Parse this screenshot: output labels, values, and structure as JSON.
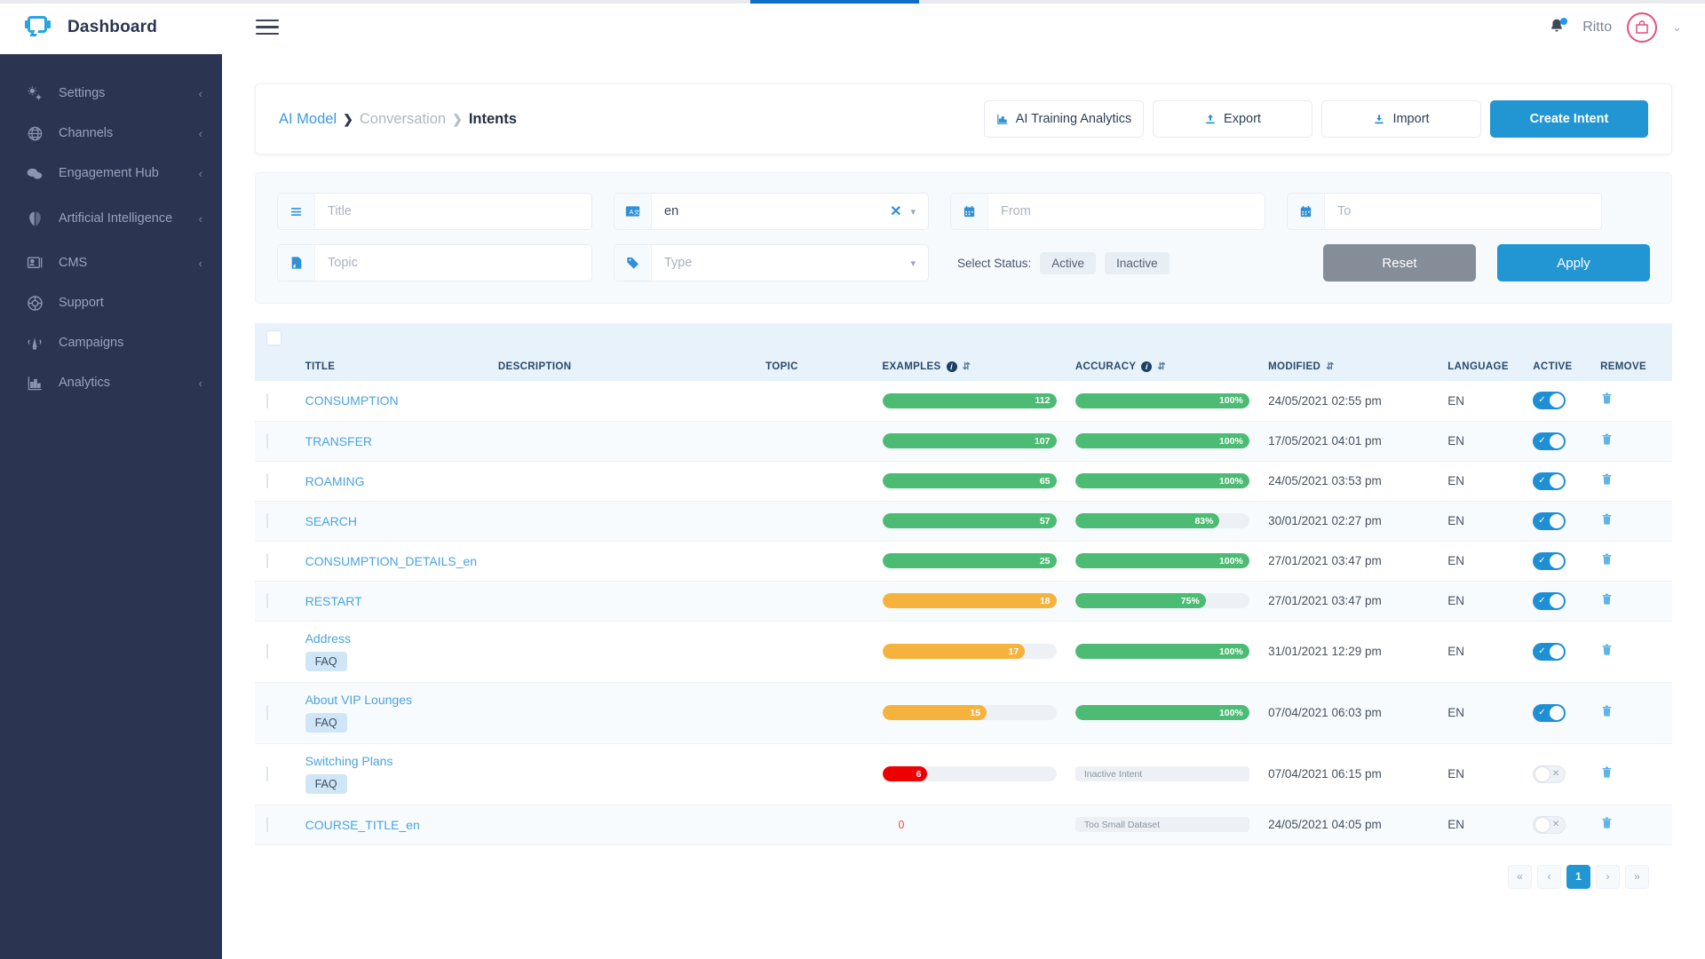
{
  "brand": {
    "title": "Dashboard",
    "logo_icon": "chat-bubble-logo"
  },
  "sidebar": {
    "items": [
      {
        "label": "Settings",
        "icon": "gears-icon",
        "chevron": "‹"
      },
      {
        "label": "Channels",
        "icon": "network-icon",
        "chevron": "‹"
      },
      {
        "label": "Engagement Hub",
        "icon": "chat-icon",
        "chevron": "‹"
      },
      {
        "label": "Artificial Intelligence",
        "icon": "brain-icon",
        "chevron": "‹"
      },
      {
        "label": "CMS",
        "icon": "content-icon",
        "chevron": "‹"
      },
      {
        "label": "Support",
        "icon": "lifebuoy-icon",
        "chevron": ""
      },
      {
        "label": "Campaigns",
        "icon": "megaphone-icon",
        "chevron": ""
      },
      {
        "label": "Analytics",
        "icon": "bar-chart-icon",
        "chevron": "‹"
      }
    ]
  },
  "topbar": {
    "menu_icon": "hamburger-icon",
    "bell_icon": "bell-icon",
    "username": "Ritto",
    "avatar_icon": "shopping-bag-avatar",
    "caret": "⌄"
  },
  "breadcrumb": {
    "level1": "AI Model",
    "sep1": "❯",
    "level2": "Conversation",
    "sep2": "❯",
    "level3": "Intents"
  },
  "actions": {
    "analytics": "AI Training Analytics",
    "export": "Export",
    "import": "Import",
    "create": "Create Intent"
  },
  "filters": {
    "title_placeholder": "Title",
    "language_value": "en",
    "from_placeholder": "From",
    "to_placeholder": "To",
    "topic_placeholder": "Topic",
    "type_placeholder": "Type",
    "status_label": "Select Status:",
    "status_active": "Active",
    "status_inactive": "Inactive",
    "reset": "Reset",
    "apply": "Apply"
  },
  "table": {
    "headers": {
      "title": "TITLE",
      "description": "DESCRIPTION",
      "topic": "TOPIC",
      "examples": "EXAMPLES",
      "accuracy": "ACCURACY",
      "modified": "MODIFIED",
      "language": "LANGUAGE",
      "active": "ACTIVE",
      "remove": "REMOVE"
    },
    "rows": [
      {
        "title": "CONSUMPTION",
        "badge": "",
        "description": "",
        "topic": "",
        "examples": "112",
        "examples_pct": 100,
        "examples_color": "green",
        "accuracy": "100%",
        "accuracy_pct": 100,
        "accuracy_color": "green",
        "accuracy_flat": "",
        "modified": "24/05/2021 02:55 pm",
        "language": "EN",
        "active": true
      },
      {
        "title": "TRANSFER",
        "badge": "",
        "description": "",
        "topic": "",
        "examples": "107",
        "examples_pct": 100,
        "examples_color": "green",
        "accuracy": "100%",
        "accuracy_pct": 100,
        "accuracy_color": "green",
        "accuracy_flat": "",
        "modified": "17/05/2021 04:01 pm",
        "language": "EN",
        "active": true
      },
      {
        "title": "ROAMING",
        "badge": "",
        "description": "",
        "topic": "",
        "examples": "65",
        "examples_pct": 100,
        "examples_color": "green",
        "accuracy": "100%",
        "accuracy_pct": 100,
        "accuracy_color": "green",
        "accuracy_flat": "",
        "modified": "24/05/2021 03:53 pm",
        "language": "EN",
        "active": true
      },
      {
        "title": "SEARCH",
        "badge": "",
        "description": "",
        "topic": "",
        "examples": "57",
        "examples_pct": 100,
        "examples_color": "green",
        "accuracy": "83%",
        "accuracy_pct": 83,
        "accuracy_color": "green",
        "accuracy_flat": "",
        "modified": "30/01/2021 02:27 pm",
        "language": "EN",
        "active": true
      },
      {
        "title": "CONSUMPTION_DETAILS_en",
        "badge": "",
        "description": "",
        "topic": "",
        "examples": "25",
        "examples_pct": 100,
        "examples_color": "green",
        "accuracy": "100%",
        "accuracy_pct": 100,
        "accuracy_color": "green",
        "accuracy_flat": "",
        "modified": "27/01/2021 03:47 pm",
        "language": "EN",
        "active": true
      },
      {
        "title": "RESTART",
        "badge": "",
        "description": "",
        "topic": "",
        "examples": "18",
        "examples_pct": 100,
        "examples_color": "orange",
        "accuracy": "75%",
        "accuracy_pct": 75,
        "accuracy_color": "green",
        "accuracy_flat": "",
        "modified": "27/01/2021 03:47 pm",
        "language": "EN",
        "active": true
      },
      {
        "title": "Address",
        "badge": "FAQ",
        "description": "",
        "topic": "",
        "examples": "17",
        "examples_pct": 82,
        "examples_color": "orange",
        "accuracy": "100%",
        "accuracy_pct": 100,
        "accuracy_color": "green",
        "accuracy_flat": "",
        "modified": "31/01/2021 12:29 pm",
        "language": "EN",
        "active": true
      },
      {
        "title": "About VIP Lounges",
        "badge": "FAQ",
        "description": "",
        "topic": "",
        "examples": "15",
        "examples_pct": 60,
        "examples_color": "orange",
        "accuracy": "100%",
        "accuracy_pct": 100,
        "accuracy_color": "green",
        "accuracy_flat": "",
        "modified": "07/04/2021 06:03 pm",
        "language": "EN",
        "active": true
      },
      {
        "title": "Switching Plans",
        "badge": "FAQ",
        "description": "",
        "topic": "",
        "examples": "6",
        "examples_pct": 26,
        "examples_color": "red",
        "accuracy": "",
        "accuracy_pct": 0,
        "accuracy_color": "",
        "accuracy_flat": "Inactive Intent",
        "modified": "07/04/2021 06:15 pm",
        "language": "EN",
        "active": false
      },
      {
        "title": "COURSE_TITLE_en",
        "badge": "",
        "description": "",
        "topic": "",
        "examples": "0",
        "examples_pct": -1,
        "examples_color": "",
        "accuracy": "",
        "accuracy_pct": 0,
        "accuracy_color": "",
        "accuracy_flat": "Too Small Dataset",
        "modified": "24/05/2021 04:05 pm",
        "language": "EN",
        "active": false
      }
    ]
  },
  "pagination": {
    "first": "«",
    "prev": "‹",
    "current": "1",
    "next": "›",
    "last": "»"
  },
  "colors": {
    "accent": "#2196d3",
    "sidebar": "#2b3450",
    "green": "#4cbb73",
    "orange": "#f5b33d",
    "red": "#ee0000",
    "link": "#4aa3e0"
  }
}
